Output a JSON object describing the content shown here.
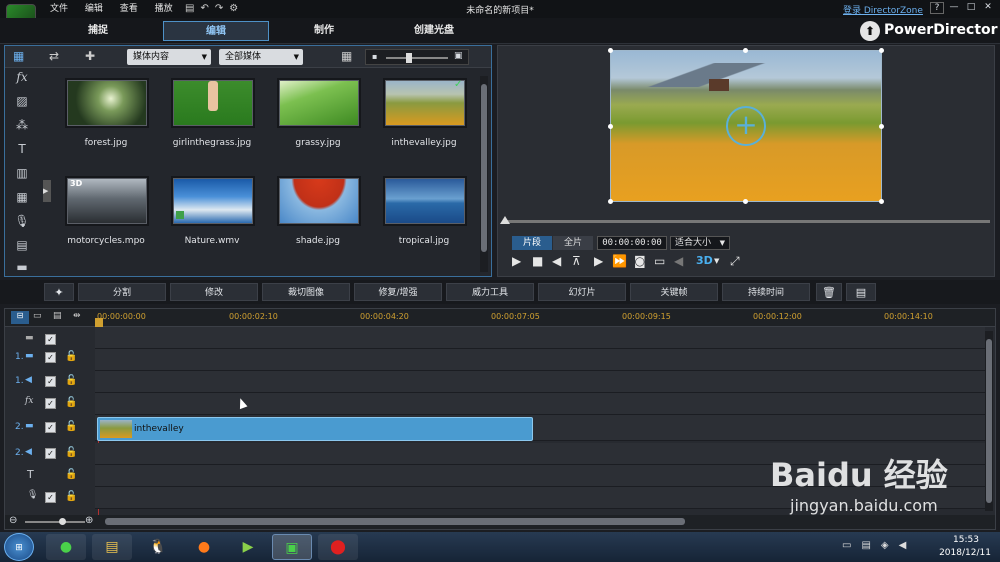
{
  "window": {
    "menu": [
      "文件",
      "编辑",
      "查看",
      "播放"
    ],
    "title": "未命名的新项目*",
    "login": "登录 DirectorZone",
    "brand": "PowerDirector",
    "controls": [
      "?",
      "—",
      "□",
      "✕"
    ]
  },
  "tabs": [
    {
      "label": "捕捉"
    },
    {
      "label": "编辑"
    },
    {
      "label": "制作"
    },
    {
      "label": "创建光盘"
    }
  ],
  "library": {
    "filter_content": "媒体内容",
    "filter_media": "全部媒体",
    "items": [
      {
        "label": "forest.jpg"
      },
      {
        "label": "girlinthegrass.jpg"
      },
      {
        "label": "grassy.jpg"
      },
      {
        "label": "inthevalley.jpg"
      },
      {
        "label": "motorcycles.mpo"
      },
      {
        "label": "Nature.wmv"
      },
      {
        "label": "shade.jpg"
      },
      {
        "label": "tropical.jpg"
      }
    ]
  },
  "preview": {
    "mode_clip": "片段",
    "mode_movie": "全片",
    "timecode": "00:00:00:00",
    "fit": "适合大小",
    "stereo": "3D"
  },
  "editbar": [
    "分割",
    "修改",
    "裁切图像",
    "修复/增强",
    "威力工具",
    "幻灯片",
    "关键帧",
    "持续时间"
  ],
  "timeline": {
    "ruler": [
      "00:00:00:00",
      "00:00:02:10",
      "00:00:04:20",
      "00:00:07:05",
      "00:00:09:15",
      "00:00:12:00",
      "00:00:14:10"
    ],
    "tracks": [
      {
        "num": "",
        "icon": "video-icon"
      },
      {
        "num": "1.",
        "icon": "video-icon"
      },
      {
        "num": "1.",
        "icon": "audio-icon"
      },
      {
        "num": "",
        "icon": "fx-icon"
      },
      {
        "num": "2.",
        "icon": "video-icon"
      },
      {
        "num": "2.",
        "icon": "audio-icon"
      },
      {
        "num": "",
        "icon": "title-icon"
      },
      {
        "num": "",
        "icon": "voice-icon"
      }
    ],
    "clip": "inthevalley"
  },
  "taskbar": {
    "time": "15:53",
    "date": "2018/12/11"
  },
  "watermark": {
    "site": "jingyan.baidu.com",
    "brand": "Baidu 经验"
  },
  "colors": {
    "accent": "#4e91c7",
    "clip": "#4a9bd0"
  }
}
